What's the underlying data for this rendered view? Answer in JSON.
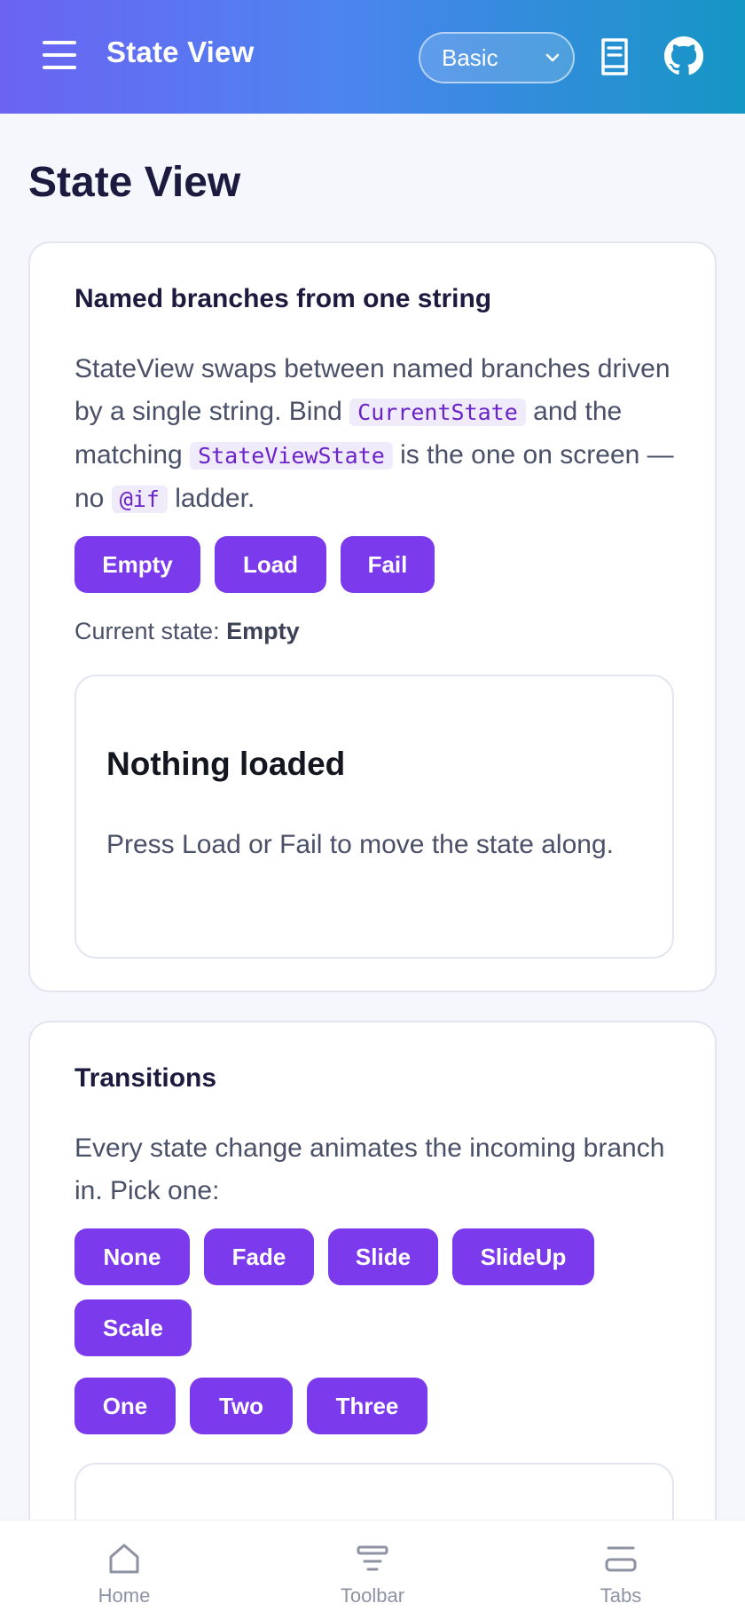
{
  "header": {
    "title": "State View",
    "mode_select": {
      "value": "Basic",
      "options": [
        "Basic"
      ]
    }
  },
  "page": {
    "title": "State View"
  },
  "card_branches": {
    "title": "Named branches from one string",
    "desc_part1": "StateView swaps between named branches driven by a single string. Bind ",
    "code1": "CurrentState",
    "desc_part2": " and the matching ",
    "code2": "StateViewState",
    "desc_part3": " is the one on screen — no ",
    "code3": "@if",
    "desc_part4": " ladder.",
    "buttons": [
      "Empty",
      "Load",
      "Fail"
    ],
    "status_label": "Current state: ",
    "status_value": "Empty",
    "state_title": "Nothing loaded",
    "state_desc": "Press Load or Fail to move the state along."
  },
  "card_transitions": {
    "title": "Transitions",
    "desc": "Every state change animates the incoming branch in. Pick one:",
    "transition_buttons": [
      "None",
      "Fade",
      "Slide",
      "SlideUp",
      "Scale"
    ],
    "step_buttons": [
      "One",
      "Two",
      "Three"
    ]
  },
  "bottom_nav": {
    "items": [
      {
        "label": "Home",
        "icon": "home-icon"
      },
      {
        "label": "Toolbar",
        "icon": "toolbar-icon"
      },
      {
        "label": "Tabs",
        "icon": "tabs-icon"
      }
    ]
  },
  "colors": {
    "accent": "#7c3aed",
    "header_start": "#6c63f3",
    "header_end": "#1596c4",
    "background": "#f5f7fd"
  }
}
